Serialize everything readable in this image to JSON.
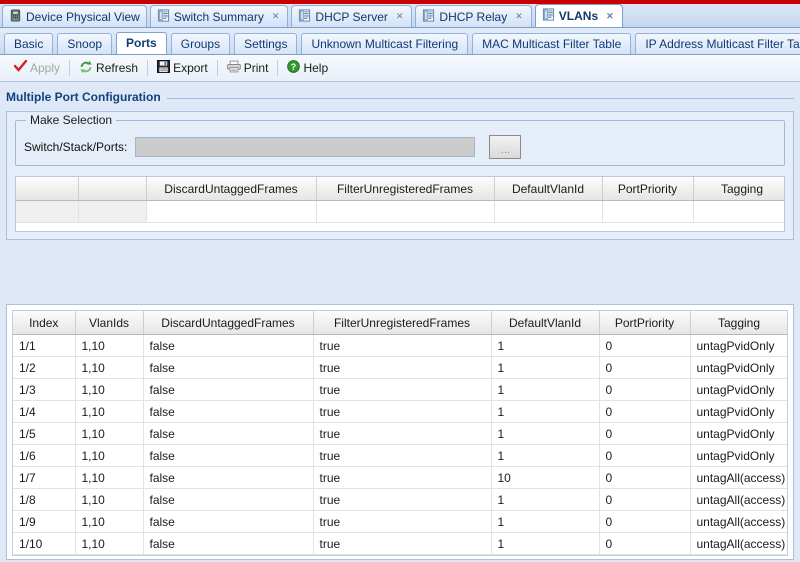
{
  "window": {
    "main_tabs": [
      {
        "label": "Device Physical View",
        "icon": "device-icon",
        "active": false,
        "closable": false
      },
      {
        "label": "Switch Summary",
        "icon": "document-icon",
        "active": false,
        "closable": true
      },
      {
        "label": "DHCP Server",
        "icon": "document-icon",
        "active": false,
        "closable": true
      },
      {
        "label": "DHCP Relay",
        "icon": "document-icon",
        "active": false,
        "closable": true
      },
      {
        "label": "VLANs",
        "icon": "document-icon",
        "active": true,
        "closable": true
      }
    ],
    "sub_tabs": [
      {
        "label": "Basic",
        "active": false
      },
      {
        "label": "Snoop",
        "active": false
      },
      {
        "label": "Ports",
        "active": true
      },
      {
        "label": "Groups",
        "active": false
      },
      {
        "label": "Settings",
        "active": false
      },
      {
        "label": "Unknown Multicast Filtering",
        "active": false
      },
      {
        "label": "MAC Multicast Filter Table",
        "active": false
      },
      {
        "label": "IP Address Multicast Filter Table",
        "active": false
      }
    ]
  },
  "toolbar": {
    "apply_label": "Apply",
    "refresh_label": "Refresh",
    "export_label": "Export",
    "print_label": "Print",
    "help_label": "Help",
    "apply_disabled": true
  },
  "section": {
    "title": "Multiple Port Configuration",
    "fieldset_legend": "Make Selection",
    "field_label": "Switch/Stack/Ports:",
    "field_value": "",
    "field_placeholder": "",
    "browse_button_label": "..."
  },
  "top_table": {
    "columns": [
      "",
      "",
      "DiscardUntaggedFrames",
      "FilterUnregisteredFrames",
      "DefaultVlanId",
      "PortPriority",
      "Tagging"
    ],
    "rows": [
      [
        "",
        "",
        "",
        "",
        "",
        "",
        ""
      ]
    ]
  },
  "port_table": {
    "columns": [
      "Index",
      "VlanIds",
      "DiscardUntaggedFrames",
      "FilterUnregisteredFrames",
      "DefaultVlanId",
      "PortPriority",
      "Tagging"
    ],
    "rows": [
      [
        "1/1",
        "1,10",
        "false",
        "true",
        "1",
        "0",
        "untagPvidOnly"
      ],
      [
        "1/2",
        "1,10",
        "false",
        "true",
        "1",
        "0",
        "untagPvidOnly"
      ],
      [
        "1/3",
        "1,10",
        "false",
        "true",
        "1",
        "0",
        "untagPvidOnly"
      ],
      [
        "1/4",
        "1,10",
        "false",
        "true",
        "1",
        "0",
        "untagPvidOnly"
      ],
      [
        "1/5",
        "1,10",
        "false",
        "true",
        "1",
        "0",
        "untagPvidOnly"
      ],
      [
        "1/6",
        "1,10",
        "false",
        "true",
        "1",
        "0",
        "untagPvidOnly"
      ],
      [
        "1/7",
        "1,10",
        "false",
        "true",
        "10",
        "0",
        "untagAll(access)"
      ],
      [
        "1/8",
        "1,10",
        "false",
        "true",
        "1",
        "0",
        "untagAll(access)"
      ],
      [
        "1/9",
        "1,10",
        "false",
        "true",
        "1",
        "0",
        "untagAll(access)"
      ],
      [
        "1/10",
        "1,10",
        "false",
        "true",
        "1",
        "0",
        "untagAll(access)"
      ]
    ]
  },
  "colors": {
    "accent_red": "#c90000",
    "header_blue": "#11417f",
    "panel_bg": "#dfe8f6",
    "grid_header": "#f1f1f1"
  }
}
